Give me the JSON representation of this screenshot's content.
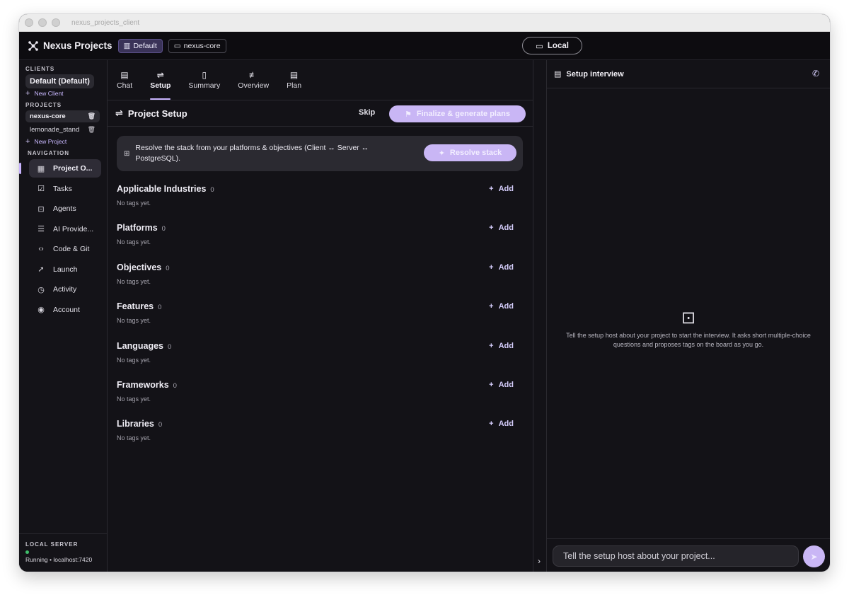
{
  "window": {
    "title": "nexus_projects_client"
  },
  "header": {
    "app_name": "Nexus Projects",
    "client_chip": "Default",
    "project_chip": "nexus-core",
    "mode_label": "Local"
  },
  "sidebar": {
    "clients_label": "CLIENTS",
    "active_client": "Default (Default)",
    "new_client": "New Client",
    "projects_label": "PROJECTS",
    "projects": [
      {
        "name": "nexus-core",
        "active": true
      },
      {
        "name": "lemonade_stand",
        "active": false
      }
    ],
    "new_project": "New Project",
    "navigation_label": "NAVIGATION",
    "nav": [
      {
        "label": "Project O...",
        "icon": "dashboard-icon",
        "active": true
      },
      {
        "label": "Tasks",
        "icon": "tasks-icon"
      },
      {
        "label": "Agents",
        "icon": "agent-icon"
      },
      {
        "label": "AI Provide...",
        "icon": "server-icon"
      },
      {
        "label": "Code & Git",
        "icon": "code-icon"
      },
      {
        "label": "Launch",
        "icon": "rocket-icon"
      },
      {
        "label": "Activity",
        "icon": "history-icon"
      },
      {
        "label": "Account",
        "icon": "account-icon"
      }
    ],
    "server_label": "LOCAL SERVER",
    "server_status": "Running • localhost:7420",
    "server_status_color": "#3fbf6a"
  },
  "tabs": [
    {
      "label": "Chat",
      "icon": "chat-icon"
    },
    {
      "label": "Setup",
      "icon": "setup-icon",
      "active": true
    },
    {
      "label": "Summary",
      "icon": "summary-icon"
    },
    {
      "label": "Overview",
      "icon": "overview-icon"
    },
    {
      "label": "Plan",
      "icon": "plan-icon"
    }
  ],
  "setup": {
    "title": "Project Setup",
    "skip": "Skip",
    "finalize": "Finalize & generate plans",
    "resolve_text": "Resolve the stack from your platforms & objectives (Client ↔ Server ↔ PostgreSQL).",
    "resolve_button": "Resolve stack",
    "add_label": "Add",
    "empty_label": "No tags yet.",
    "categories": [
      {
        "name": "Applicable Industries",
        "count": "0"
      },
      {
        "name": "Platforms",
        "count": "0"
      },
      {
        "name": "Objectives",
        "count": "0"
      },
      {
        "name": "Features",
        "count": "0"
      },
      {
        "name": "Languages",
        "count": "0"
      },
      {
        "name": "Frameworks",
        "count": "0"
      },
      {
        "name": "Libraries",
        "count": "0"
      }
    ]
  },
  "interview": {
    "title": "Setup interview",
    "empty_text": "Tell the setup host about your project to start the interview. It asks short multiple-choice questions and proposes tags on the board as you go.",
    "input_placeholder": "Tell the setup host about your project..."
  },
  "colors": {
    "accent": "#c9b6f5",
    "background": "#131217",
    "panel": "#2b2a31"
  }
}
